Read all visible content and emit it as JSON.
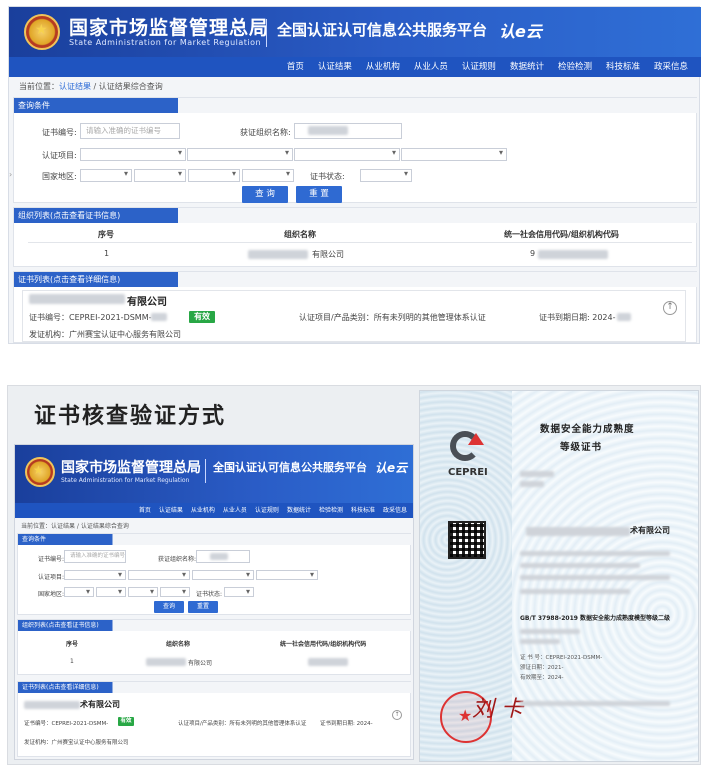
{
  "banner": {
    "title": "国家市场监督管理总局",
    "subtitle": "State Administration for Market Regulation",
    "platform": "全国认证认可信息公共服务平台",
    "logo_text": "认e云"
  },
  "nav": {
    "items": [
      "首页",
      "认证结果",
      "从业机构",
      "从业人员",
      "认证规则",
      "数据统计",
      "检验检测",
      "科技标准",
      "政采信息"
    ]
  },
  "breadcrumb": {
    "prefix": "当前位置：",
    "link": "认证结果",
    "sep": " / ",
    "current": "认证结果综合查询"
  },
  "query": {
    "section_title": "查询条件",
    "cert_no_label": "证书编号:",
    "cert_no_placeholder": "请输入准确的证书编号",
    "org_label": "获证组织名称:",
    "item_label": "认证项目:",
    "region_label": "国家地区:",
    "status_label": "证书状态:",
    "search_button": "查 询",
    "reset_button": "重 置"
  },
  "org_list": {
    "section_title": "组织列表(点击查看证书信息)",
    "columns": [
      "序号",
      "组织名称",
      "统一社会信用代码/组织机构代码"
    ],
    "rows": [
      {
        "index": "1",
        "name_tail": "有限公司",
        "code_head": "9"
      }
    ]
  },
  "cert_list": {
    "section_title": "证书列表(点击查看详细信息)",
    "company_tail": "有限公司",
    "cert_no": "证书编号：CEPREI-2021-DSMM-",
    "status_badge": "有效",
    "category": "认证项目/产品类别：所有未列明的其他管理体系认证",
    "expiry": "证书到期日期: 2024-",
    "issuer": "发证机构：广州赛宝认证中心服务有限公司"
  },
  "bottom": {
    "title": "证书核查验证方式",
    "mini_header_title": "国家市场监督管理总局",
    "mini_header_sub": "State Administration for Market Regulation",
    "mini_platform": "全国认证认可信息公共服务平台",
    "mini_logo": "认e云",
    "mini_nav": [
      "首页",
      "认证结果",
      "从业机构",
      "从业人员",
      "认证规则",
      "数据统计",
      "检验检测",
      "科技标准",
      "政采信息"
    ],
    "mini_crumb": "当前位置：认证结果 / 认证结果综合查询",
    "mini_query_title": "查询条件",
    "mini_cert_no_label": "证书编号:",
    "mini_cert_no_placeholder": "请输入准确的证书编号",
    "mini_org_label": "获证组织名称:",
    "mini_item_label": "认证项目:",
    "mini_region_label": "国家地区:",
    "mini_status_label": "证书状态:",
    "mini_search": "查询",
    "mini_reset": "重置",
    "mini_org_title": "组织列表(点击查看证书信息)",
    "mini_cols": [
      "序号",
      "组织名称",
      "统一社会信用代码/组织机构代码"
    ],
    "mini_row_index": "1",
    "mini_row_tail": "有限公司",
    "mini_cert_title": "证书列表(点击查看详细信息)",
    "mini_company_tail": "术有限公司",
    "mini_cert_no": "证书编号：CEPREI-2021-DSMM-",
    "mini_badge": "有效",
    "mini_category": "认证项目/产品类别：所有未列明的其他管理体系认证",
    "mini_expiry": "证书到期日期: 2024-",
    "mini_issuer": "发证机构：广州赛宝认证中心服务有限公司"
  },
  "certificate": {
    "logo_text": "CEPREI",
    "title_line1": "数据安全能力成熟度",
    "title_line2": "等级证书",
    "company_tail": "术有限公司",
    "standard": "GB/T 37988-2019 数据安全能力成熟度模型等级二级",
    "cert_no_label": "证 书 号：CEPREI-2021-DSMM-",
    "issue_label": "颁证日期：2021-",
    "expiry_label": "有效期至：2024-",
    "sign_name": "刘 卡"
  },
  "colors": {
    "banner": "#1f54c0",
    "button": "#2f6ad2",
    "valid_badge": "#28a745",
    "link": "#2a6ad6"
  }
}
